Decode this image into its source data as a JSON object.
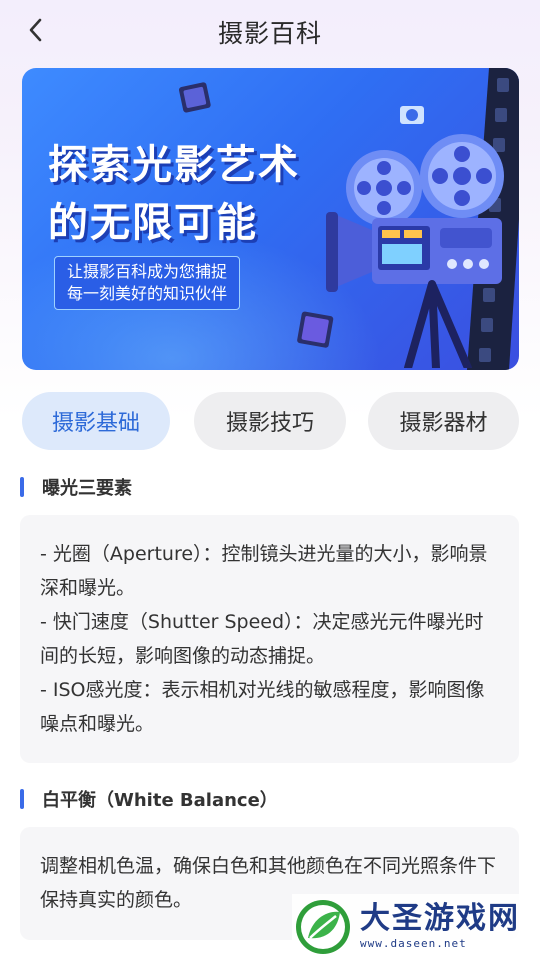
{
  "header": {
    "title": "摄影百科"
  },
  "banner": {
    "title_line1": "探索光影艺术",
    "title_line2": "的无限可能",
    "caption_line1": "让摄影百科成为您捕捉",
    "caption_line2": "每一刻美好的知识伙伴"
  },
  "tabs": [
    {
      "label": "摄影基础",
      "active": true
    },
    {
      "label": "摄影技巧",
      "active": false
    },
    {
      "label": "摄影器材",
      "active": false
    }
  ],
  "sections": [
    {
      "title": "曝光三要素",
      "lines": [
        "- 光圈（Aperture）：控制镜头进光量的大小，影响景深和曝光。",
        "- 快门速度（Shutter Speed）：决定感光元件曝光时间的长短，影响图像的动态捕捉。",
        "- ISO感光度：表示相机对光线的敏感程度，影响图像噪点和曝光。"
      ]
    },
    {
      "title": "白平衡（White Balance）",
      "lines": [
        "调整相机色温，确保白色和其他颜色在不同光照条件下保持真实的颜色。"
      ]
    }
  ],
  "watermark": {
    "name": "大圣游戏网",
    "url": "www.daseen.net"
  },
  "colors": {
    "accent": "#3a6be8",
    "active_tab_bg": "#dde9fb",
    "active_tab_text": "#2d6ad8",
    "banner_blue": "#2f6ef3"
  },
  "icons": {
    "back": "chevron-left-icon",
    "camera": "film-camera-icon",
    "logo": "leaf-logo-icon"
  }
}
